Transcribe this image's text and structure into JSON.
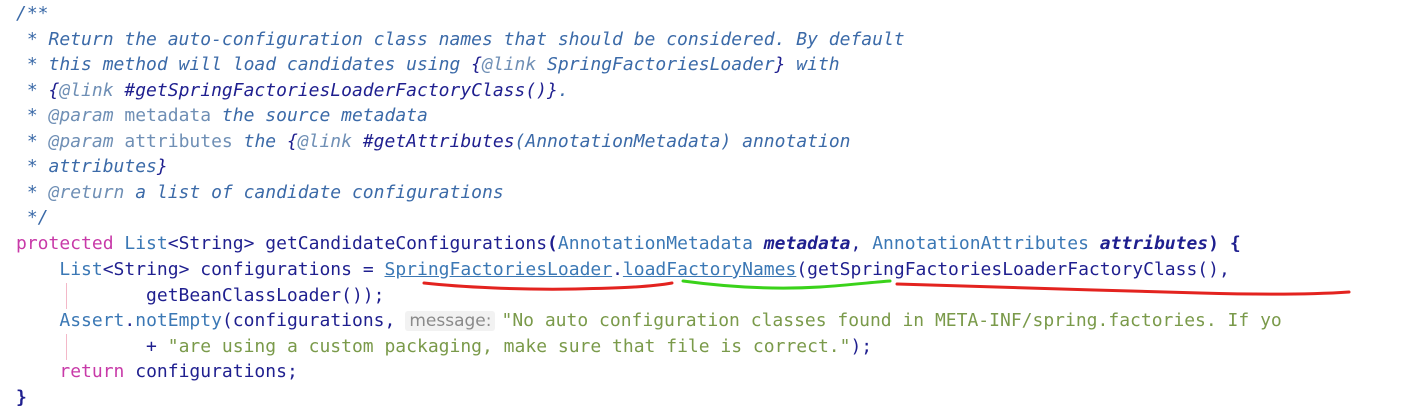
{
  "javadoc": {
    "open": "/**",
    "l1_text": " * Return the auto-configuration class names that should be considered. By default",
    "l2_prefix": " * this method will load candidates using ",
    "l2_brace_open": "{",
    "l2_link_tag": "@link",
    "l2_link_target": " SpringFactoriesLoader",
    "l2_brace_close": "}",
    "l2_suffix": " with",
    "l3_prefix": " * ",
    "l3_brace_open": "{",
    "l3_link_tag": "@link",
    "l3_link_target": " #getSpringFactoriesLoaderFactoryClass()",
    "l3_brace_close": "}",
    "l3_suffix": ".",
    "l4_prefix": " * ",
    "l4_tag": "@param",
    "l4_name": " metadata",
    "l4_desc": " the source metadata",
    "l5_prefix": " * ",
    "l5_tag": "@param",
    "l5_name": " attributes",
    "l5_desc": " the ",
    "l5_brace_open": "{",
    "l5_link_tag": "@link",
    "l5_link_method": " #getAttributes",
    "l5_link_args": "(AnnotationMetadata)",
    "l5_desc2": " annotation",
    "l6_text": " * attributes",
    "l6_brace_close": "}",
    "l7_prefix": " * ",
    "l7_tag": "@return",
    "l7_desc": " a list of candidate configurations",
    "close": " */"
  },
  "code": {
    "sig_kw": "protected",
    "sig_type": " List",
    "sig_generic": "<String>",
    "sig_method": " getCandidateConfigurations",
    "sig_open": "(",
    "sig_p1_type": "AnnotationMetadata",
    "sig_p1_name": " metadata",
    "sig_comma": ",",
    "sig_p2_type": " AnnotationAttributes",
    "sig_p2_name": " attributes",
    "sig_close": ")",
    "sig_brace": " {",
    "l1_indent": "    ",
    "l1_type": "List",
    "l1_generic": "<String>",
    "l1_var": " configurations",
    "l1_eq": " = ",
    "l1_class": "SpringFactoriesLoader",
    "l1_dot": ".",
    "l1_method": "loadFactoryNames",
    "l1_open": "(",
    "l1_arg": "getSpringFactoriesLoaderFactoryClass",
    "l1_argparens": "()",
    "l1_comma": ",",
    "l2_indent": "            ",
    "l2_call": "getBeanClassLoader",
    "l2_rest": "());",
    "l3_indent": "    ",
    "l3_class": "Assert",
    "l3_dot": ".",
    "l3_method": "notEmpty",
    "l3_open": "(",
    "l3_arg": "configurations",
    "l3_comma": ",",
    "l3_hint": "message:",
    "l3_str": "\"No auto configuration classes found in META-INF/spring.factories. If yo",
    "l4_indent": "            ",
    "l4_plus": "+ ",
    "l4_str": "\"are using a custom packaging, make sure that file is correct.\"",
    "l4_end": ");",
    "l5_indent": "    ",
    "l5_kw": "return",
    "l5_var": " configurations",
    "l5_semi": ";",
    "close": "}"
  },
  "annotations": {
    "red_color": "#e3231f",
    "green_color": "#3ad21a"
  }
}
